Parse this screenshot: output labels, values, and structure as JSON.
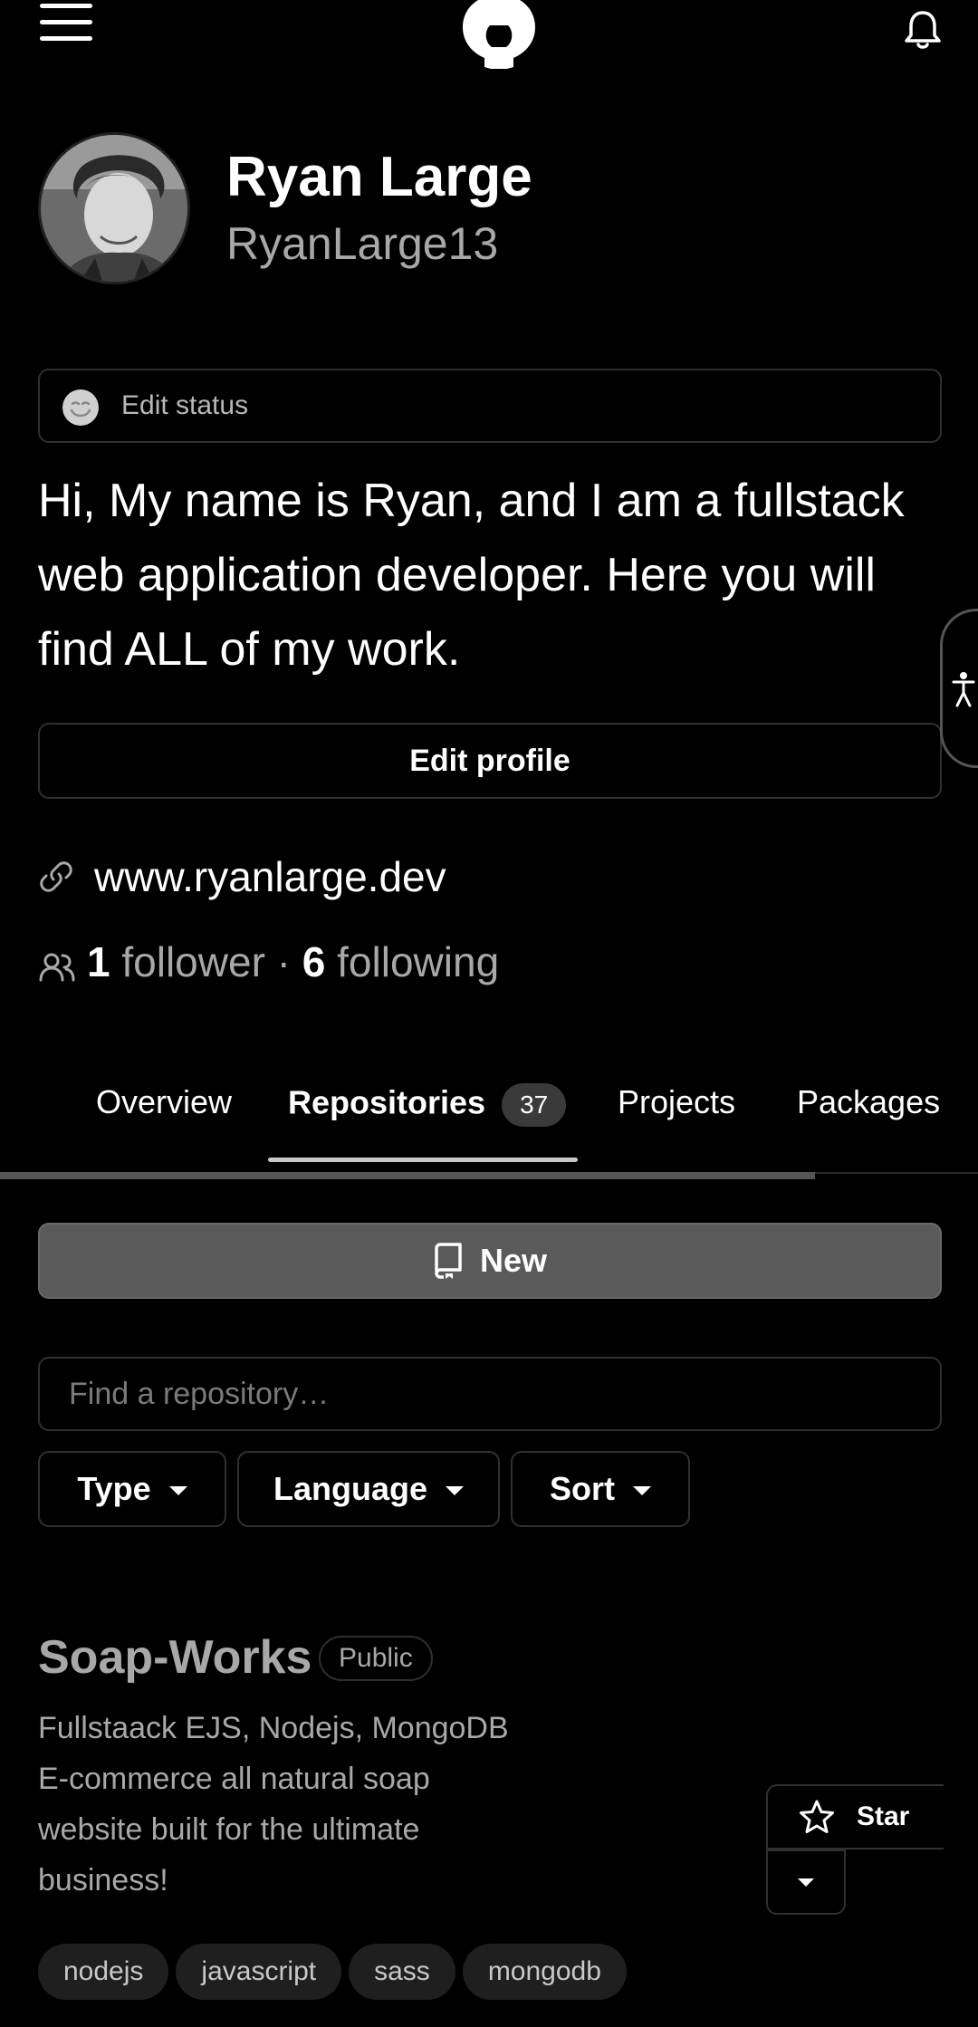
{
  "header": {
    "menu_icon": "hamburger-icon",
    "logo_icon": "github-icon",
    "notification_icon": "bell-icon"
  },
  "profile": {
    "name": "Ryan Large",
    "username": "RyanLarge13",
    "status_placeholder": "Edit status",
    "bio": "Hi, My name is Ryan, and I am a fullstack web application developer. Here you will find ALL of my work.",
    "edit_profile_label": "Edit profile",
    "website": "www.ryanlarge.dev",
    "followers_count": "1",
    "followers_label": "follower",
    "separator": "·",
    "following_count": "6",
    "following_label": "following"
  },
  "tabs": [
    {
      "label": "Overview"
    },
    {
      "label": "Repositories",
      "count": "37",
      "active": true
    },
    {
      "label": "Projects"
    },
    {
      "label": "Packages"
    }
  ],
  "repo_toolbar": {
    "new_label": "New",
    "search_placeholder": "Find a repository…",
    "filters": [
      "Type",
      "Language",
      "Sort"
    ]
  },
  "repositories": [
    {
      "name": "Soap-Works",
      "visibility": "Public",
      "description": "Fullstaack EJS, Nodejs, MongoDB E-commerce all natural soap website built for the ultimate business!",
      "star_label": "Star",
      "topics": [
        "nodejs",
        "javascript",
        "sass",
        "mongodb"
      ]
    }
  ],
  "colors": {
    "background": "#000000",
    "text": "#ffffff",
    "muted": "#a8a8a8",
    "border": "#303030",
    "new_button": "#5a5a5a"
  }
}
